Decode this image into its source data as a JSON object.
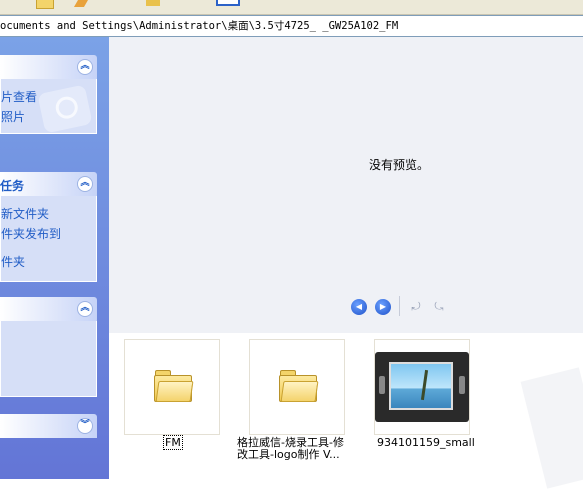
{
  "address": {
    "path": "ocuments and Settings\\Administrator\\桌面\\3.5寸4725_ _GW25A102_FM"
  },
  "sidebar": {
    "panels": [
      {
        "tasks": [
          "片查看",
          "照片"
        ]
      },
      {
        "title": "任务",
        "tasks": [
          "新文件夹",
          "件夹发布到",
          "件夹"
        ]
      },
      {
        "tasks": []
      },
      {
        "tasks": []
      }
    ]
  },
  "preview": {
    "message": "没有预览。"
  },
  "thumbnails": [
    {
      "type": "folder",
      "label": "FM"
    },
    {
      "type": "folder",
      "label_line1": "格拉威信-烧录工具-修",
      "label_line2": "改工具-logo制作 V..."
    },
    {
      "type": "image",
      "label": "934101159_small"
    }
  ],
  "colors": {
    "sidebar_gradient_top": "#7ba2e7",
    "sidebar_gradient_bottom": "#6375d6",
    "task_link": "#215dc6",
    "preview_bg": "#eff1f6"
  },
  "icons": {
    "chevron_up": "chevron-up-icon",
    "chevron_down": "chevron-down-icon",
    "prev": "previous-image-icon",
    "next": "next-image-icon",
    "rotate_cw": "rotate-clockwise-icon",
    "rotate_ccw": "rotate-counterclockwise-icon"
  }
}
